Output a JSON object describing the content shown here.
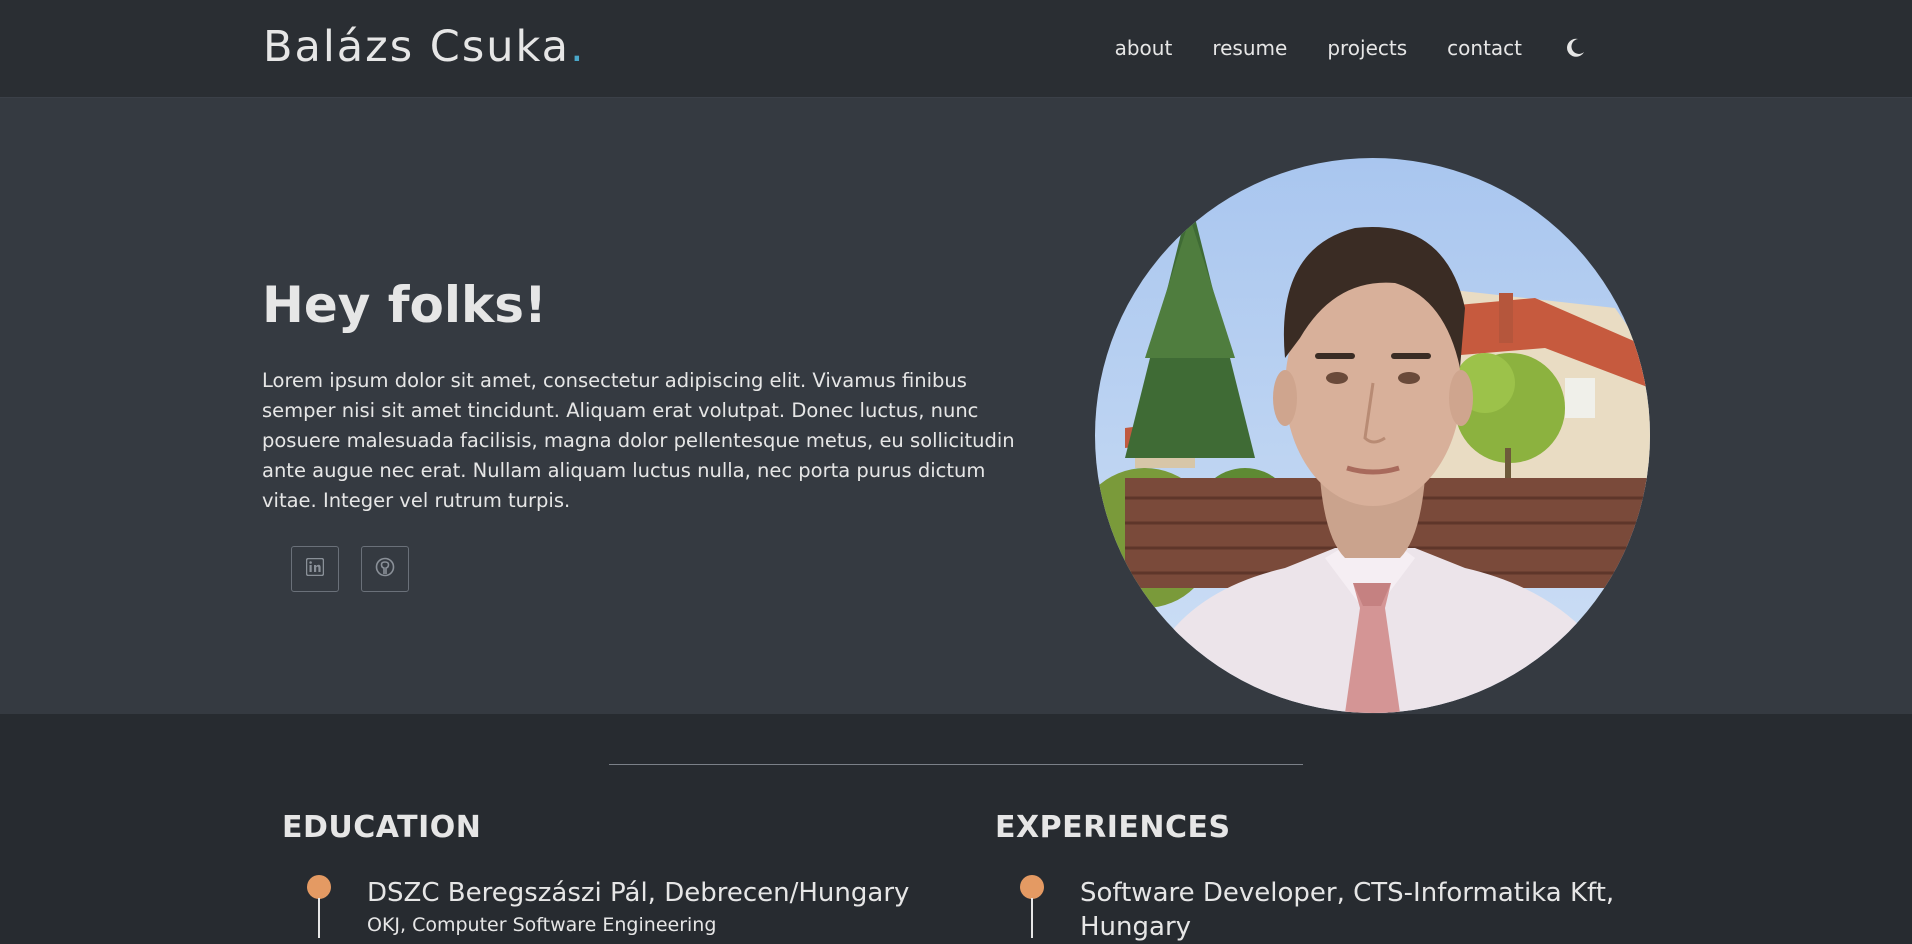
{
  "header": {
    "brand_name": "Balázs Csuka",
    "brand_dot": ".",
    "nav": [
      {
        "label": "about"
      },
      {
        "label": "resume"
      },
      {
        "label": "projects"
      },
      {
        "label": "contact"
      }
    ],
    "theme_toggle_icon": "moon-icon"
  },
  "hero": {
    "heading": "Hey folks!",
    "intro": "Lorem ipsum dolor sit amet, consectetur adipiscing elit. Vivamus finibus semper nisi sit amet tincidunt. Aliquam erat volutpat. Donec luctus, nunc posuere malesuada facilisis, magna dolor pellentesque metus, eu sollicitudin ante augue nec erat. Nullam aliquam luctus nulla, nec porta purus dictum vitae. Integer vel rutrum turpis.",
    "social": [
      {
        "icon": "linkedin-icon"
      },
      {
        "icon": "github-icon"
      }
    ]
  },
  "resume": {
    "education": {
      "title": "EDUCATION",
      "items": [
        {
          "title": "DSZC Beregszászi Pál, Debrecen/Hungary",
          "subtitle": "OKJ, Computer Software Engineering"
        }
      ]
    },
    "experiences": {
      "title": "EXPERIENCES",
      "items": [
        {
          "title": "Software Developer, CTS-Informatika Kft,",
          "subtitle": "Hungary"
        }
      ]
    }
  },
  "colors": {
    "accent_dot": "#4aa7c9",
    "timeline_dot": "#e49a63",
    "header_bg": "#2a2e33",
    "hero_bg": "#353a41",
    "page_bg": "#272b30"
  }
}
